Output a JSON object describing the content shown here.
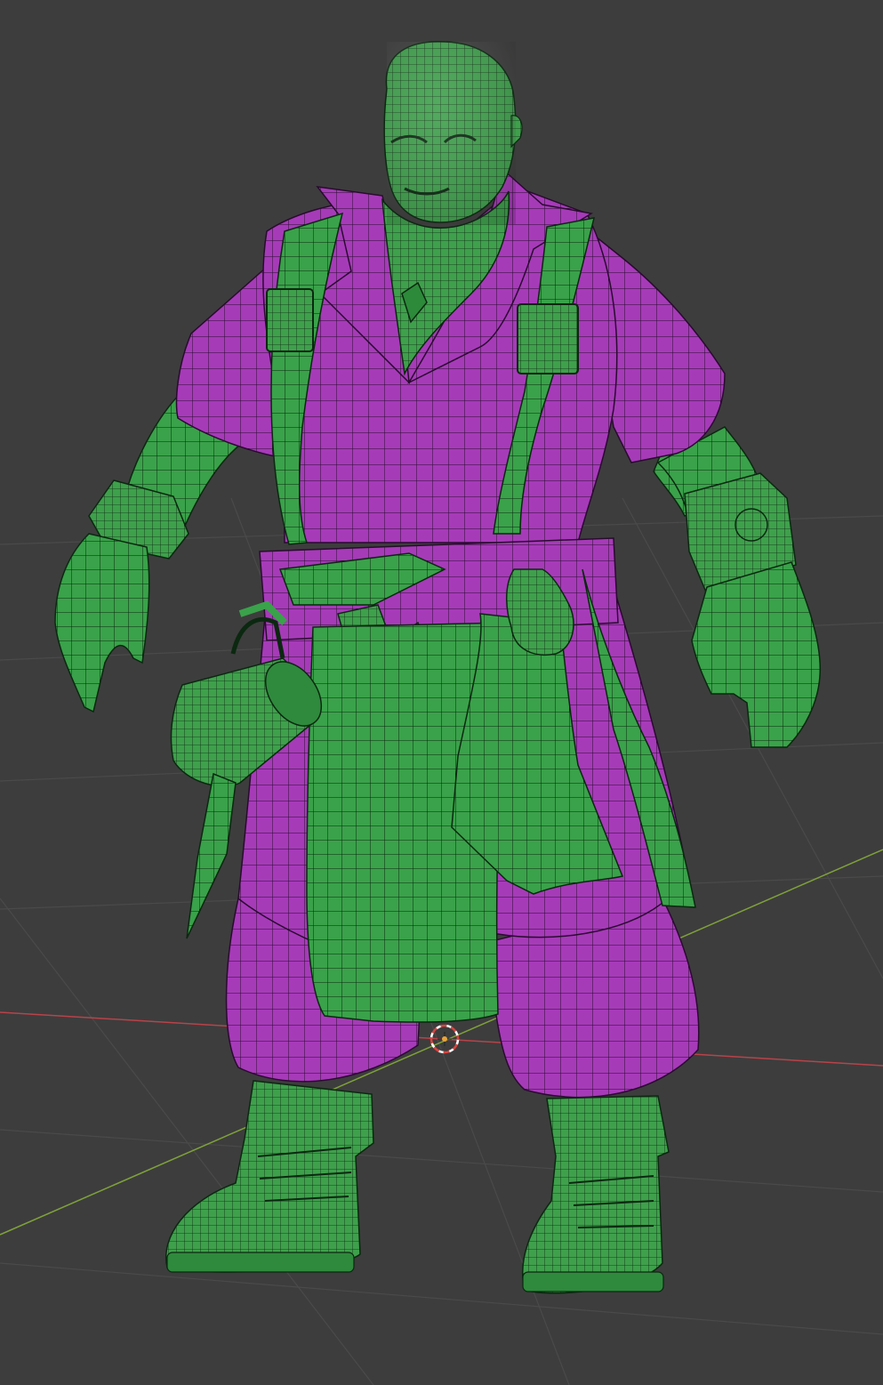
{
  "viewport": {
    "background_color": "#3d3d3d",
    "grid_color": "#4a4a4a",
    "x_axis_color": "#b8434a",
    "y_axis_color": "#7fa23a"
  },
  "model": {
    "primary_material_color": "#3aa24a",
    "secondary_material_color": "#a63bb8",
    "wire_color": "#0a1a0c"
  },
  "origin_marker": {
    "icon": "3d-cursor-icon"
  }
}
